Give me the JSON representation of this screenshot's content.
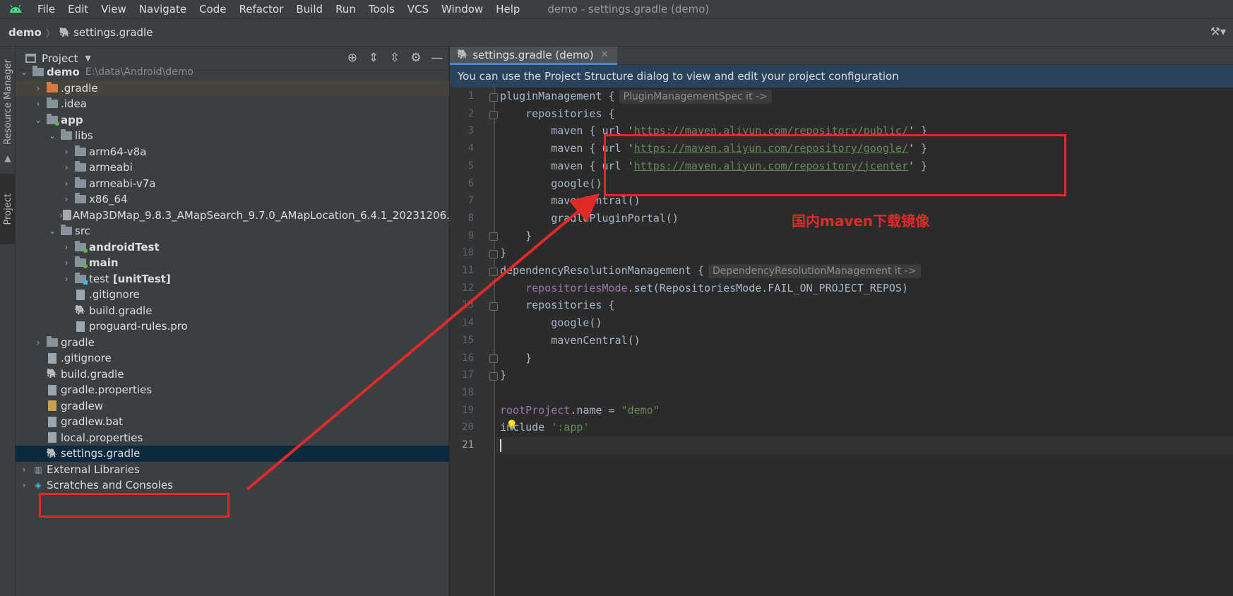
{
  "menubar": {
    "logo_icon": "android-icon",
    "items": [
      "File",
      "Edit",
      "View",
      "Navigate",
      "Code",
      "Refactor",
      "Build",
      "Run",
      "Tools",
      "VCS",
      "Window",
      "Help"
    ],
    "window_title": "demo - settings.gradle (demo)"
  },
  "breadcrumb": {
    "root": "demo",
    "file": "settings.gradle"
  },
  "left_strip": {
    "resource_manager": "Resource Manager",
    "project": "Project"
  },
  "project_panel": {
    "title": "Project",
    "tree": [
      {
        "label": "demo",
        "path": "E:\\data\\Android\\demo"
      },
      {
        "label": ".gradle"
      },
      {
        "label": ".idea"
      },
      {
        "label": "app"
      },
      {
        "label": "libs"
      },
      {
        "label": "arm64-v8a"
      },
      {
        "label": "armeabi"
      },
      {
        "label": "armeabi-v7a"
      },
      {
        "label": "x86_64"
      },
      {
        "label": "AMap3DMap_9.8.3_AMapSearch_9.7.0_AMapLocation_6.4.1_20231206.jar"
      },
      {
        "label": "src"
      },
      {
        "label": "androidTest"
      },
      {
        "label": "main"
      },
      {
        "label": "test",
        "extra": "[unitTest]"
      },
      {
        "label": ".gitignore"
      },
      {
        "label": "build.gradle"
      },
      {
        "label": "proguard-rules.pro"
      },
      {
        "label": "gradle"
      },
      {
        "label": ".gitignore"
      },
      {
        "label": "build.gradle"
      },
      {
        "label": "gradle.properties"
      },
      {
        "label": "gradlew"
      },
      {
        "label": "gradlew.bat"
      },
      {
        "label": "local.properties"
      },
      {
        "label": "settings.gradle"
      },
      {
        "label": "External Libraries"
      },
      {
        "label": "Scratches and Consoles"
      }
    ]
  },
  "editor": {
    "tab_label": "settings.gradle (demo)",
    "banner": "You can use the Project Structure dialog to view and edit your project configuration",
    "current_line": 21,
    "lines": {
      "l1_code": "pluginManagement {",
      "l1_hint": "PluginManagementSpec it ->",
      "l2": "    repositories {",
      "l3_pre": "        maven { url '",
      "l3_url": "https://maven.aliyun.com/repository/public/",
      "l3_post": "' }",
      "l4_pre": "        maven { url '",
      "l4_url": "https://maven.aliyun.com/repository/google/",
      "l4_post": "' }",
      "l5_pre": "        maven { url '",
      "l5_url": "https://maven.aliyun.com/repository/jcenter",
      "l5_post": "' }",
      "l6": "        google()",
      "l7": "        mavenCentral()",
      "l8": "        gradlePluginPortal()",
      "l9": "    }",
      "l10": "}",
      "l11_code": "dependencyResolutionManagement {",
      "l11_hint": "DependencyResolutionManagement it ->",
      "l12_prop": "repositoriesMode",
      "l12_rest": ".set(RepositoriesMode.FAIL_ON_PROJECT_REPOS)",
      "l13": "    repositories {",
      "l14": "        google()",
      "l15": "        mavenCentral()",
      "l16": "    }",
      "l17": "}",
      "l18": "",
      "l19_prop": "rootProject",
      "l19_mid": ".name = ",
      "l19_str": "\"demo\"",
      "l20_kw": "include ",
      "l20_str": "':app'"
    }
  },
  "annotation": {
    "text": "国内maven下载镜像",
    "color": "#e02a2a"
  }
}
